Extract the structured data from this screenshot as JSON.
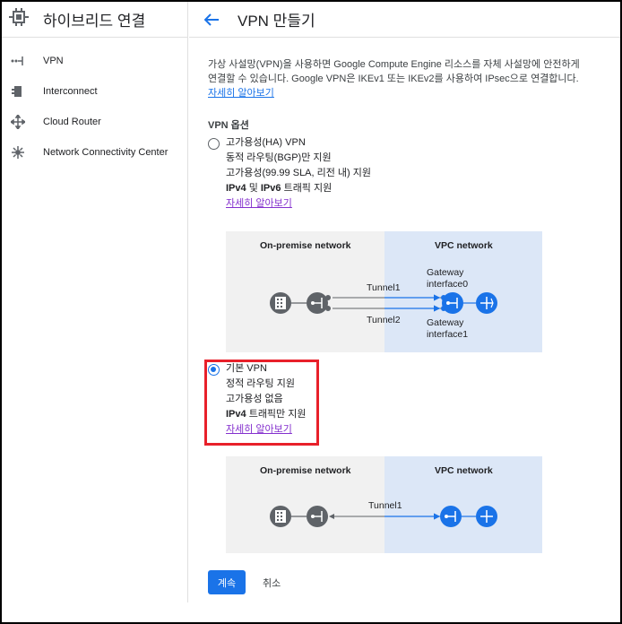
{
  "sidebar": {
    "title": "하이브리드 연결",
    "items": [
      {
        "label": "VPN",
        "icon": "vpn-icon"
      },
      {
        "label": "Interconnect",
        "icon": "interconnect-icon"
      },
      {
        "label": "Cloud Router",
        "icon": "cloud-router-icon"
      },
      {
        "label": "Network Connectivity Center",
        "icon": "network-connectivity-center-icon"
      }
    ]
  },
  "header": {
    "title": "VPN 만들기",
    "back_icon": "arrow-back-icon"
  },
  "intro": {
    "line1": "가상 사설망(VPN)을 사용하면 Google Compute Engine 리소스를 자체 사설망에 안전하게",
    "line2": "연결할 수 있습니다. Google VPN은 IKEv1 또는 IKEv2를 사용하여 IPsec으로 연결합니다.",
    "learn_more": "자세히 알아보기"
  },
  "options_heading": "VPN 옵션",
  "options": [
    {
      "title": "고가용성(HA) VPN",
      "lines": [
        "동적 라우팅(BGP)만 지원",
        "고가용성(99.99 SLA, 리전 내) 지원"
      ],
      "bold_line_prefix": "IPv4",
      "bold_line_mid": " 및 ",
      "bold_line_bold2": "IPv6",
      "bold_line_suffix": " 트래픽 지원",
      "learn_more": "자세히 알아보기",
      "checked": false
    },
    {
      "title": "기본 VPN",
      "lines": [
        "정적 라우팅 지원",
        "고가용성 없음"
      ],
      "bold_line_prefix": "IPv4",
      "bold_line_suffix": " 트래픽만 지원",
      "learn_more": "자세히 알아보기",
      "checked": true
    }
  ],
  "diagram_ha": {
    "left_title": "On-premise network",
    "right_title": "VPC network",
    "tunnel1": "Tunnel1",
    "tunnel2": "Tunnel2",
    "gw0_line1": "Gateway",
    "gw0_line2": "interface0",
    "gw1_line1": "Gateway",
    "gw1_line2": "interface1"
  },
  "diagram_classic": {
    "left_title": "On-premise network",
    "right_title": "VPC network",
    "tunnel1": "Tunnel1"
  },
  "actions": {
    "continue": "계속",
    "cancel": "취소"
  },
  "colors": {
    "accent": "#1a73e8",
    "highlight": "#e8202a",
    "visited_link": "#8430ce"
  }
}
